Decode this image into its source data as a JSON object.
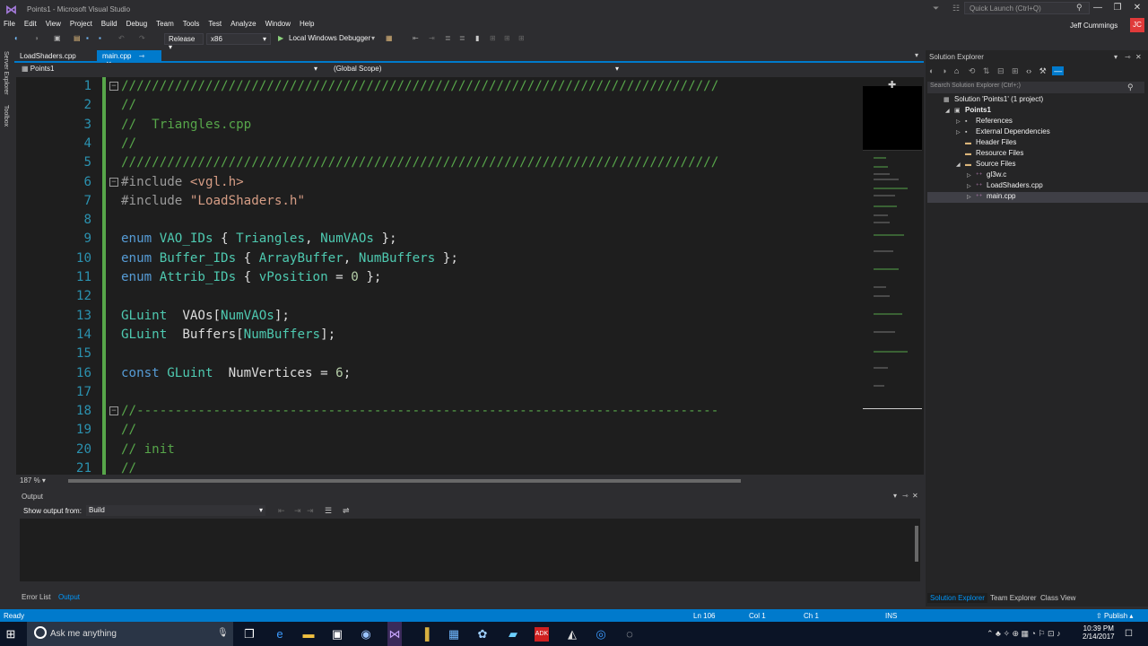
{
  "window": {
    "title": "Points1 - Microsoft Visual Studio",
    "quick_launch_placeholder": "Quick Launch (Ctrl+Q)",
    "user_name": "Jeff Cummings",
    "user_initials": "JC",
    "min": "—",
    "restore": "❐",
    "close": "✕"
  },
  "menu": [
    "File",
    "Edit",
    "View",
    "Project",
    "Build",
    "Debug",
    "Team",
    "Tools",
    "Test",
    "Analyze",
    "Window",
    "Help"
  ],
  "toolbar": {
    "configuration": "Release",
    "platform": "x86",
    "debugger": "Local Windows Debugger"
  },
  "side_tabs": [
    "Server Explorer",
    "Toolbox"
  ],
  "doc_tabs": [
    {
      "label": "LoadShaders.cpp",
      "active": false
    },
    {
      "label": "main.cpp",
      "active": true
    }
  ],
  "navbar": {
    "project": "Points1",
    "scope": "(Global Scope)"
  },
  "code": [
    {
      "n": "1",
      "fold": "−",
      "parts": [
        {
          "c": "cm",
          "t": "//////////////////////////////////////////////////////////////////////////////"
        }
      ]
    },
    {
      "n": "2",
      "parts": [
        {
          "c": "cm",
          "t": "//"
        }
      ]
    },
    {
      "n": "3",
      "parts": [
        {
          "c": "cm",
          "t": "//  Triangles.cpp"
        }
      ]
    },
    {
      "n": "4",
      "parts": [
        {
          "c": "cm",
          "t": "//"
        }
      ]
    },
    {
      "n": "5",
      "parts": [
        {
          "c": "cm",
          "t": "//////////////////////////////////////////////////////////////////////////////"
        }
      ]
    },
    {
      "n": "6",
      "fold": "−",
      "parts": [
        {
          "c": "pp",
          "t": "#include "
        },
        {
          "c": "st",
          "t": "<vgl.h>"
        }
      ]
    },
    {
      "n": "7",
      "parts": [
        {
          "c": "pp",
          "t": "#include "
        },
        {
          "c": "st",
          "t": "\"LoadShaders.h\""
        }
      ]
    },
    {
      "n": "8",
      "parts": []
    },
    {
      "n": "9",
      "parts": [
        {
          "c": "kw",
          "t": "enum "
        },
        {
          "c": "ty",
          "t": "VAO_IDs"
        },
        {
          "c": "id",
          "t": " { "
        },
        {
          "c": "ty",
          "t": "Triangles"
        },
        {
          "c": "id",
          "t": ", "
        },
        {
          "c": "ty",
          "t": "NumVAOs"
        },
        {
          "c": "id",
          "t": " };"
        }
      ]
    },
    {
      "n": "10",
      "parts": [
        {
          "c": "kw",
          "t": "enum "
        },
        {
          "c": "ty",
          "t": "Buffer_IDs"
        },
        {
          "c": "id",
          "t": " { "
        },
        {
          "c": "ty",
          "t": "ArrayBuffer"
        },
        {
          "c": "id",
          "t": ", "
        },
        {
          "c": "ty",
          "t": "NumBuffers"
        },
        {
          "c": "id",
          "t": " };"
        }
      ]
    },
    {
      "n": "11",
      "parts": [
        {
          "c": "kw",
          "t": "enum "
        },
        {
          "c": "ty",
          "t": "Attrib_IDs"
        },
        {
          "c": "id",
          "t": " { "
        },
        {
          "c": "ty",
          "t": "vPosition"
        },
        {
          "c": "id",
          "t": " = "
        },
        {
          "c": "nm",
          "t": "0"
        },
        {
          "c": "id",
          "t": " };"
        }
      ]
    },
    {
      "n": "12",
      "parts": []
    },
    {
      "n": "13",
      "parts": [
        {
          "c": "ty",
          "t": "GLuint"
        },
        {
          "c": "id",
          "t": "  VAOs["
        },
        {
          "c": "ty",
          "t": "NumVAOs"
        },
        {
          "c": "id",
          "t": "];"
        }
      ]
    },
    {
      "n": "14",
      "parts": [
        {
          "c": "ty",
          "t": "GLuint"
        },
        {
          "c": "id",
          "t": "  Buffers["
        },
        {
          "c": "ty",
          "t": "NumBuffers"
        },
        {
          "c": "id",
          "t": "];"
        }
      ]
    },
    {
      "n": "15",
      "parts": []
    },
    {
      "n": "16",
      "parts": [
        {
          "c": "kw",
          "t": "const "
        },
        {
          "c": "ty",
          "t": "GLuint"
        },
        {
          "c": "id",
          "t": "  NumVertices = "
        },
        {
          "c": "nm",
          "t": "6"
        },
        {
          "c": "id",
          "t": ";"
        }
      ]
    },
    {
      "n": "17",
      "parts": []
    },
    {
      "n": "18",
      "fold": "−",
      "parts": [
        {
          "c": "cm",
          "t": "//----------------------------------------------------------------------------"
        }
      ]
    },
    {
      "n": "19",
      "parts": [
        {
          "c": "cm",
          "t": "//"
        }
      ]
    },
    {
      "n": "20",
      "parts": [
        {
          "c": "cm",
          "t": "// init"
        }
      ]
    },
    {
      "n": "21",
      "parts": [
        {
          "c": "cm",
          "t": "//"
        }
      ]
    }
  ],
  "editor": {
    "zoom": "187 %"
  },
  "output": {
    "title": "Output",
    "show_from_label": "Show output from:",
    "source": "Build"
  },
  "bottom_tabs": [
    "Error List",
    "Output"
  ],
  "solution_explorer": {
    "title": "Solution Explorer",
    "search_placeholder": "Search Solution Explorer (Ctrl+;)",
    "tree": [
      {
        "label": "Solution 'Points1' (1 project)",
        "level": 0,
        "expander": ""
      },
      {
        "label": "Points1",
        "level": 1,
        "expander": "◢",
        "bold": true
      },
      {
        "label": "References",
        "level": 2,
        "expander": "▷"
      },
      {
        "label": "External Dependencies",
        "level": 2,
        "expander": "▷"
      },
      {
        "label": "Header Files",
        "level": 2,
        "expander": ""
      },
      {
        "label": "Resource Files",
        "level": 2,
        "expander": ""
      },
      {
        "label": "Source Files",
        "level": 2,
        "expander": "◢"
      },
      {
        "label": "gl3w.c",
        "level": 3,
        "expander": "▷"
      },
      {
        "label": "LoadShaders.cpp",
        "level": 3,
        "expander": "▷"
      },
      {
        "label": "main.cpp",
        "level": 3,
        "expander": "▷",
        "selected": true
      }
    ],
    "tabs": [
      "Solution Explorer",
      "Team Explorer",
      "Class View"
    ]
  },
  "status": {
    "state": "Ready",
    "line": "Ln 106",
    "col": "Col 1",
    "ch": "Ch 1",
    "mode": "INS",
    "publish": "Publish"
  },
  "taskbar": {
    "search": "Ask me anything",
    "time": "10:39 PM",
    "date": "2/14/2017"
  }
}
